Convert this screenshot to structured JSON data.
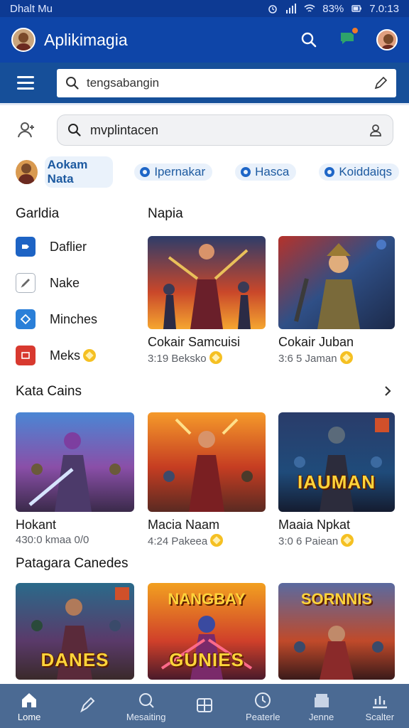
{
  "status_bar": {
    "carrier": "Dhalt Mu",
    "battery": "83%",
    "time": "7.0:13"
  },
  "app_bar": {
    "title": "Aplikimagia"
  },
  "search_primary": {
    "text": "tengsabangin"
  },
  "search_secondary": {
    "text": "mvplintacen"
  },
  "chips": {
    "user_label": "Aokam Nata",
    "items": [
      "Ipernakar",
      "Hasca",
      "Koiddaiqs"
    ]
  },
  "sidebar": {
    "heading": "Garldia",
    "items": [
      {
        "label": "Daflier",
        "icon": "tag-icon"
      },
      {
        "label": "Nake",
        "icon": "edit-icon"
      },
      {
        "label": "Minches",
        "icon": "diamond-icon"
      },
      {
        "label": "Meks",
        "icon": "card-icon"
      }
    ]
  },
  "featured": {
    "heading": "Napia",
    "cards": [
      {
        "name": "Cokair Samcuisi",
        "meta": "3:19 Beksko",
        "overlay": ""
      },
      {
        "name": "Cokair Juban",
        "meta": "3:6 5 Jaman",
        "overlay": ""
      }
    ]
  },
  "section_kata": {
    "heading": "Kata Cains",
    "cards": [
      {
        "name": "Hokant",
        "meta": "430:0 kmaa 0/0",
        "overlay": ""
      },
      {
        "name": "Macia Naam",
        "meta": "4:24 Pakeea",
        "overlay": ""
      },
      {
        "name": "Maaia Npkat",
        "meta": "3:0 6 Paiean",
        "overlay": "IAUMAN"
      }
    ]
  },
  "section_patagara": {
    "heading": "Patagara Canedes",
    "cards": [
      {
        "overlay_bottom": "DANES",
        "overlay_top": ""
      },
      {
        "overlay_bottom": "GUNIES",
        "overlay_top": "NANGBAY"
      },
      {
        "overlay_bottom": "",
        "overlay_top": "SORNNIS"
      }
    ]
  },
  "bottom_nav": {
    "items": [
      {
        "label": "Lome",
        "icon": "home-icon"
      },
      {
        "label": "",
        "icon": "pen-icon"
      },
      {
        "label": "Mesaiting",
        "icon": "search-icon"
      },
      {
        "label": "",
        "icon": "grid-icon"
      },
      {
        "label": "Peaterle",
        "icon": "clock-icon"
      },
      {
        "label": "Jenne",
        "icon": "store-icon"
      },
      {
        "label": "Scalter",
        "icon": "chart-icon"
      }
    ]
  },
  "colors": {
    "appbar": "#0e45a8",
    "accent": "#1d5aa0",
    "bottom_nav": "#4b6a93"
  }
}
